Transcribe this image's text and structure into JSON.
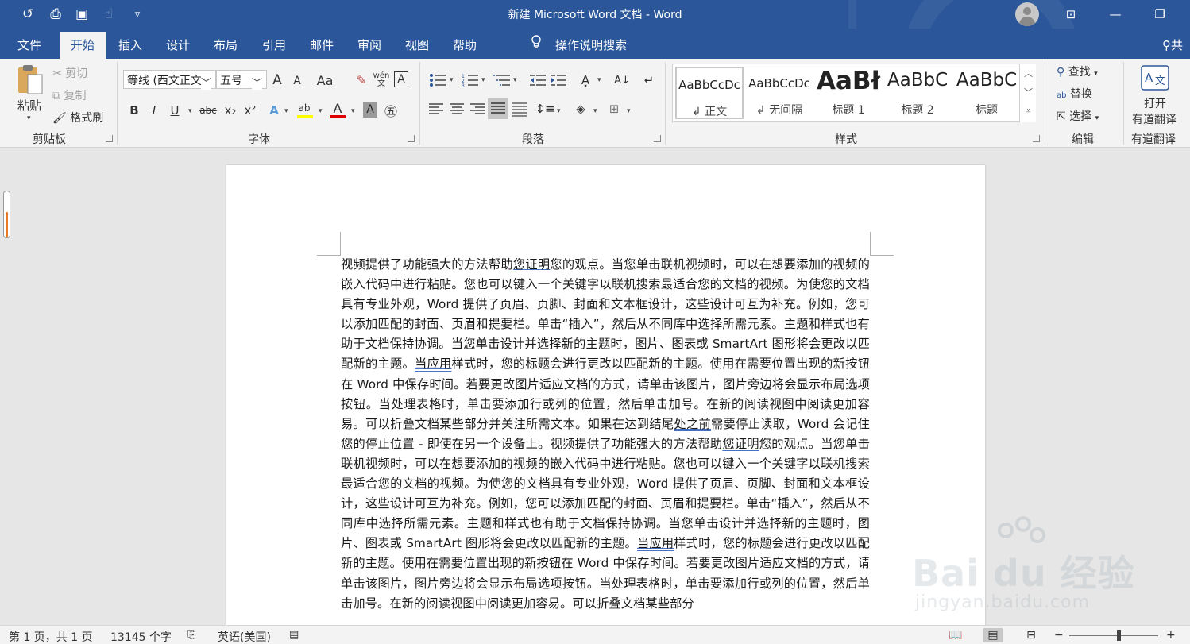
{
  "titlebar": {
    "title": "新建 Microsoft Word 文档  -  Word",
    "qat": [
      {
        "name": "autosave-icon",
        "glyph": "↺"
      },
      {
        "name": "print-preview-icon",
        "glyph": "⎙"
      },
      {
        "name": "save-icon",
        "glyph": "▣"
      },
      {
        "name": "touch-mode-icon",
        "glyph": "☝"
      },
      {
        "name": "customize-qat-icon",
        "glyph": "▿"
      }
    ],
    "window_buttons": {
      "ribbon_display": "⊡",
      "minimize": "—",
      "restore": "❐"
    }
  },
  "menu": {
    "tabs": [
      "文件",
      "开始",
      "插入",
      "设计",
      "布局",
      "引用",
      "邮件",
      "审阅",
      "视图",
      "帮助"
    ],
    "active_tab": "开始",
    "tell_me": "操作说明搜索",
    "share": "共"
  },
  "ribbon": {
    "clipboard": {
      "paste": "粘贴",
      "cut": "剪切",
      "copy": "复制",
      "format_painter": "格式刷",
      "label": "剪贴板"
    },
    "font": {
      "family": "等线 (西文正文)",
      "size": "五号",
      "grow": "A",
      "shrink": "A",
      "change_case": "Aa",
      "phonetic": "wén文",
      "char_border": "A",
      "bold": "B",
      "italic": "I",
      "underline": "U",
      "strike": "abc",
      "subscript": "x₂",
      "superscript": "x²",
      "text_effects": "A",
      "highlight": "ab",
      "font_color": "A",
      "char_shading": "A",
      "enclose": "㊄",
      "label": "字体",
      "highlight_color": "#ffff00",
      "font_color_value": "#e00000"
    },
    "paragraph": {
      "label": "段落"
    },
    "styles": {
      "items": [
        {
          "sample": "AaBbCcDc",
          "name": "↲ 正文",
          "size": 15
        },
        {
          "sample": "AaBbCcDc",
          "name": "↲ 无间隔",
          "size": 15
        },
        {
          "sample": "AaBł",
          "name": "标题 1",
          "size": 31
        },
        {
          "sample": "AaBbC",
          "name": "标题 2",
          "size": 23
        },
        {
          "sample": "AaBbC",
          "name": "标题",
          "size": 23
        }
      ],
      "label": "样式"
    },
    "editing": {
      "find": "查找",
      "replace": "替换",
      "select": "选择",
      "label": "编辑"
    },
    "youdao": {
      "open": "打开",
      "name": "有道翻译",
      "label": "有道翻译"
    }
  },
  "document": {
    "paragraphs": [
      [
        "视频提供了功能强大的方法帮助",
        {
          "t": "您证明",
          "g": true
        },
        "您的观点。当您单击联机视频时，可以在想要添加的视频的嵌入代码中进行粘贴。您也可以键入一个关键字以联机搜索最适合您的文档的视频。为使您的文档具有专业外观，Word 提供了页眉、页脚、封面和文本框设计，这些设计可互为补充。例如，您可以添加匹配的封面、页眉和提要栏。单击“插入”，然后从不同库中选择所需元素。主题和样式也有助于文档保持协调。当您单击设计并选择新的主题时，图片、图表或 SmartArt 图形将会更改以匹配新的主题。",
        {
          "t": "当应用",
          "g": true
        },
        "样式时，您的标题会进行更改以匹配新的主题。使用在需要位置出现的新按钮在 Word 中保存时间。若要更改图片适应文档的方式，请单击该图片，图片旁边将会显示布局选项按钮。当处理表格时，单击要添加行或列的位置，然后单击加号。在新的阅读视图中阅读更加容易。可以折叠文档某些部分并关注所需文本。如果在达到结尾",
        {
          "t": "处之前",
          "g": true
        },
        "需要停止读取，Word 会记住您的停止位置 - 即使在另一个设备上。视频提供了功能强大的方法帮助",
        {
          "t": "您证明",
          "g": true
        },
        "您的观点。当您单击联机视频时，可以在想要添加的视频的嵌入代码中进行粘贴。您也可以键入一个关键字以联机搜索最适合您的文档的视频。为使您的文档具有专业外观，Word 提供了页眉、页脚、封面和文本框设计，这些设计可互为补充。例如，您可以添加匹配的封面、页眉和提要栏。单击“插入”，然后从不同库中选择所需元素。主题和样式也有助于文档保持协调。当您单击设计并选择新的主题时，图片、图表或 SmartArt 图形将会更改以匹配新的主题。",
        {
          "t": "当应用",
          "g": true
        },
        "样式时，您的标题会进行更改以匹配新的主题。使用在需要位置出现的新按钮在 Word 中保存时间。若要更改图片适应文档的方式，请单击该图片，图片旁边将会显示布局选项按钮。当处理表格时，单击要添加行或列的位置，然后单击加号。在新的阅读视图中阅读更加容易。可以折叠文档某些部分"
      ]
    ]
  },
  "watermark": {
    "text": "Bai du 经验",
    "url": "jingyan.baidu.com"
  },
  "statusbar": {
    "page": "第 1 页，共 1 页",
    "words": "13145 个字",
    "language": "英语(美国)",
    "zoom_minus": "−",
    "zoom_plus": "+",
    "zoom_level": 0.55
  },
  "colors": {
    "accent": "#2b579a",
    "proofing_underline": "#4472c4"
  }
}
